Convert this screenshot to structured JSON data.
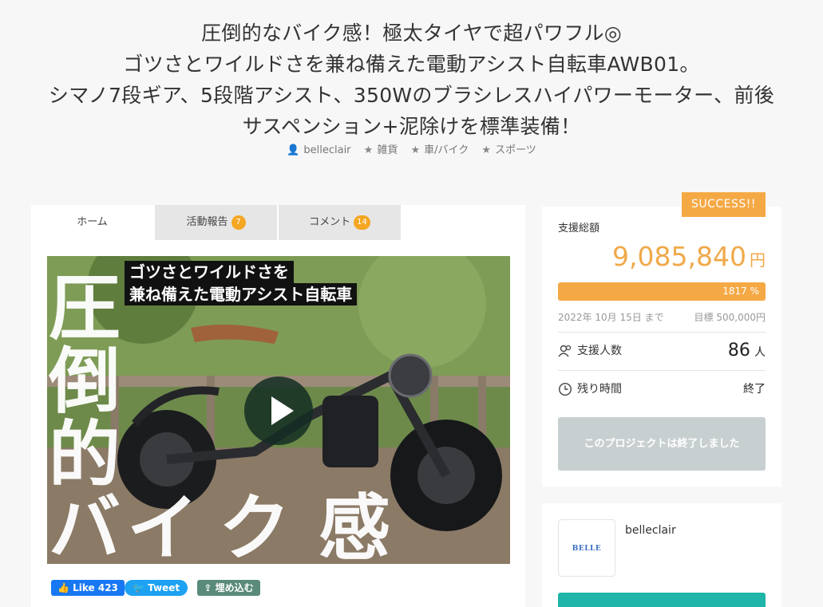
{
  "header": {
    "title_lines": [
      "圧倒的なバイク感！極太タイヤで超パワフル◎",
      "ゴツさとワイルドさを兼ね備えた電動アシスト自転車AWB01。",
      "シマノ7段ギア、5段階アシスト、350Wのブラシレスハイパワーモーター、前後",
      "サスペンション+泥除けを標準装備！"
    ],
    "owner": "belleclair",
    "categories": [
      "雑貨",
      "車/バイク",
      "スポーツ"
    ]
  },
  "tabs": [
    {
      "label": "ホーム",
      "count": ""
    },
    {
      "label": "活動報告",
      "count": "7"
    },
    {
      "label": "コメント",
      "count": "14"
    }
  ],
  "video": {
    "overlay_line1": "ゴツさとワイルドさを",
    "overlay_line2": "兼ね備えた電動アシスト自転車",
    "big_text": [
      "圧",
      "倒",
      "的",
      "バ",
      "イ",
      "ク",
      "感"
    ]
  },
  "share": {
    "like": "Like 423",
    "tweet": "Tweet",
    "embed": "埋め込む",
    "colors": {
      "like": "#1877f2",
      "tweet": "#1da1f2",
      "embed": "#5a8b7a"
    }
  },
  "funding": {
    "badge": "SUCCESS!!",
    "total_label": "支援総額",
    "amount": "9,085,840",
    "currency": "円",
    "progress_text": "1817 %",
    "progress_percent": 1817,
    "deadline": "2022年 10月 15日 まで",
    "goal": "目標 500,000円",
    "backers_label": "支援人数",
    "backers_value": "86",
    "backers_unit": "人",
    "remaining_label": "残り時間",
    "remaining_value": "終了",
    "ended_button": "このプロジェクトは終了しました",
    "accent": "#f5a945"
  },
  "owner_card": {
    "logo_text": "BELLE CLAIR",
    "name": "belleclair",
    "accent": "#1fb5a8"
  }
}
